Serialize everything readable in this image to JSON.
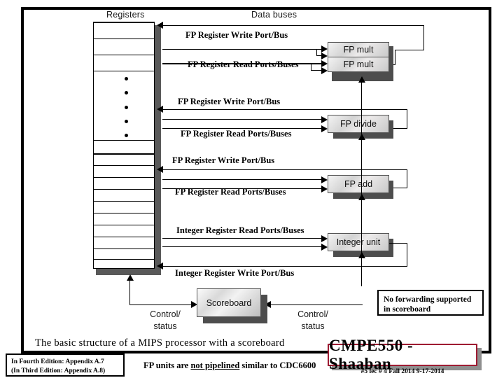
{
  "page": {
    "title": "The basic structure of a MIPS processor with a scoreboard"
  },
  "headings": {
    "registers": "Registers",
    "data_buses": "Data buses"
  },
  "buses": [
    {
      "id": "fp-mult-write",
      "label": "FP Register Write Port/Bus"
    },
    {
      "id": "fp-mult-read",
      "label": "FP Register Read Ports/Buses"
    },
    {
      "id": "fp-div-write",
      "label": "FP Register Write Port/Bus"
    },
    {
      "id": "fp-div-read",
      "label": "FP Register Read Ports/Buses"
    },
    {
      "id": "fp-add-write",
      "label": "FP Register Write Port/Bus"
    },
    {
      "id": "fp-add-read",
      "label": "FP Register Read Ports/Buses"
    },
    {
      "id": "int-read",
      "label": "Integer Register Read Ports/Buses"
    },
    {
      "id": "int-write",
      "label": "Integer Register Write Port/Bus"
    }
  ],
  "units": [
    {
      "id": "fp-mult-1",
      "label": "FP mult"
    },
    {
      "id": "fp-mult-2",
      "label": "FP mult"
    },
    {
      "id": "fp-divide",
      "label": "FP divide"
    },
    {
      "id": "fp-add",
      "label": "FP add"
    },
    {
      "id": "integer",
      "label": "Integer unit"
    }
  ],
  "scoreboard": {
    "label": "Scoreboard",
    "control_left": "Control/\nstatus",
    "control_left_line1": "Control/",
    "control_left_line2": "status",
    "control_right_line1": "Control/",
    "control_right_line2": "status"
  },
  "note": {
    "line1": "No forwarding supported",
    "line2": "in scoreboard"
  },
  "footer": {
    "edition_line1": "In Fourth Edition:  Appendix A.7",
    "edition_line2": "(In Third Edition: Appendix A.8)",
    "pipeline_pre": "FP units are ",
    "pipeline_emph": "not pipelined",
    "pipeline_post": " similar to CDC6600"
  },
  "banner": {
    "title": "CMPE550 - Shaaban",
    "subtitle": "#5   lec # 4  Fall 2014    9-17-2014",
    "accent": "#9e1b32"
  },
  "registers": {
    "row_count": 16,
    "ellipsis_dots": 5
  }
}
